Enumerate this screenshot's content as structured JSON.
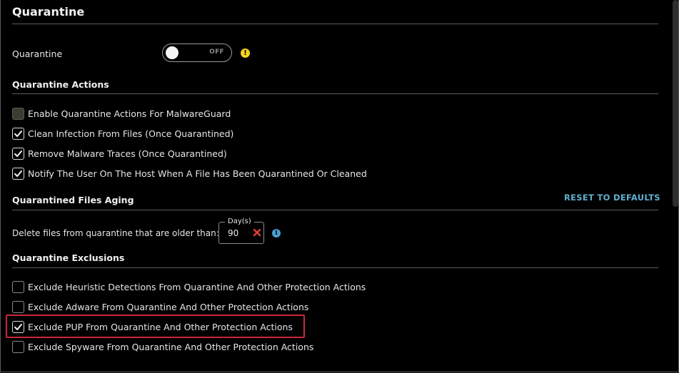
{
  "page": {
    "title": "Quarantine"
  },
  "quarantine_toggle": {
    "label": "Quarantine",
    "state": "OFF",
    "warning_icon": "!"
  },
  "actions": {
    "title": "Quarantine Actions",
    "items": [
      {
        "label": "Enable Quarantine Actions For MalwareGuard",
        "checked": false,
        "disabled": true
      },
      {
        "label": "Clean Infection From Files (Once Quarantined)",
        "checked": true
      },
      {
        "label": "Remove Malware Traces (Once Quarantined)",
        "checked": true
      },
      {
        "label": "Notify The User On The Host When A File Has Been Quarantined Or Cleaned",
        "checked": true
      }
    ]
  },
  "aging": {
    "title": "Quarantined Files Aging",
    "reset_label": "RESET TO DEFAULTS",
    "delete_label": "Delete files from quarantine that are older than:",
    "days_legend": "Day(s)",
    "days_value": "90",
    "info_icon": "i"
  },
  "exclusions": {
    "title": "Quarantine Exclusions",
    "items": [
      {
        "label": "Exclude Heuristic Detections From Quarantine And Other Protection Actions",
        "checked": false
      },
      {
        "label": "Exclude Adware From Quarantine And Other Protection Actions",
        "checked": false
      },
      {
        "label": "Exclude PUP From Quarantine And Other Protection Actions",
        "checked": true,
        "highlighted": true
      },
      {
        "label": "Exclude Spyware From Quarantine And Other Protection Actions",
        "checked": false
      }
    ]
  },
  "colors": {
    "accent_link": "#5fb0cf",
    "warning": "#f4d21f",
    "info": "#4aa0d0",
    "clear_icon": "#e0403a",
    "highlight_border": "#c8283b"
  }
}
